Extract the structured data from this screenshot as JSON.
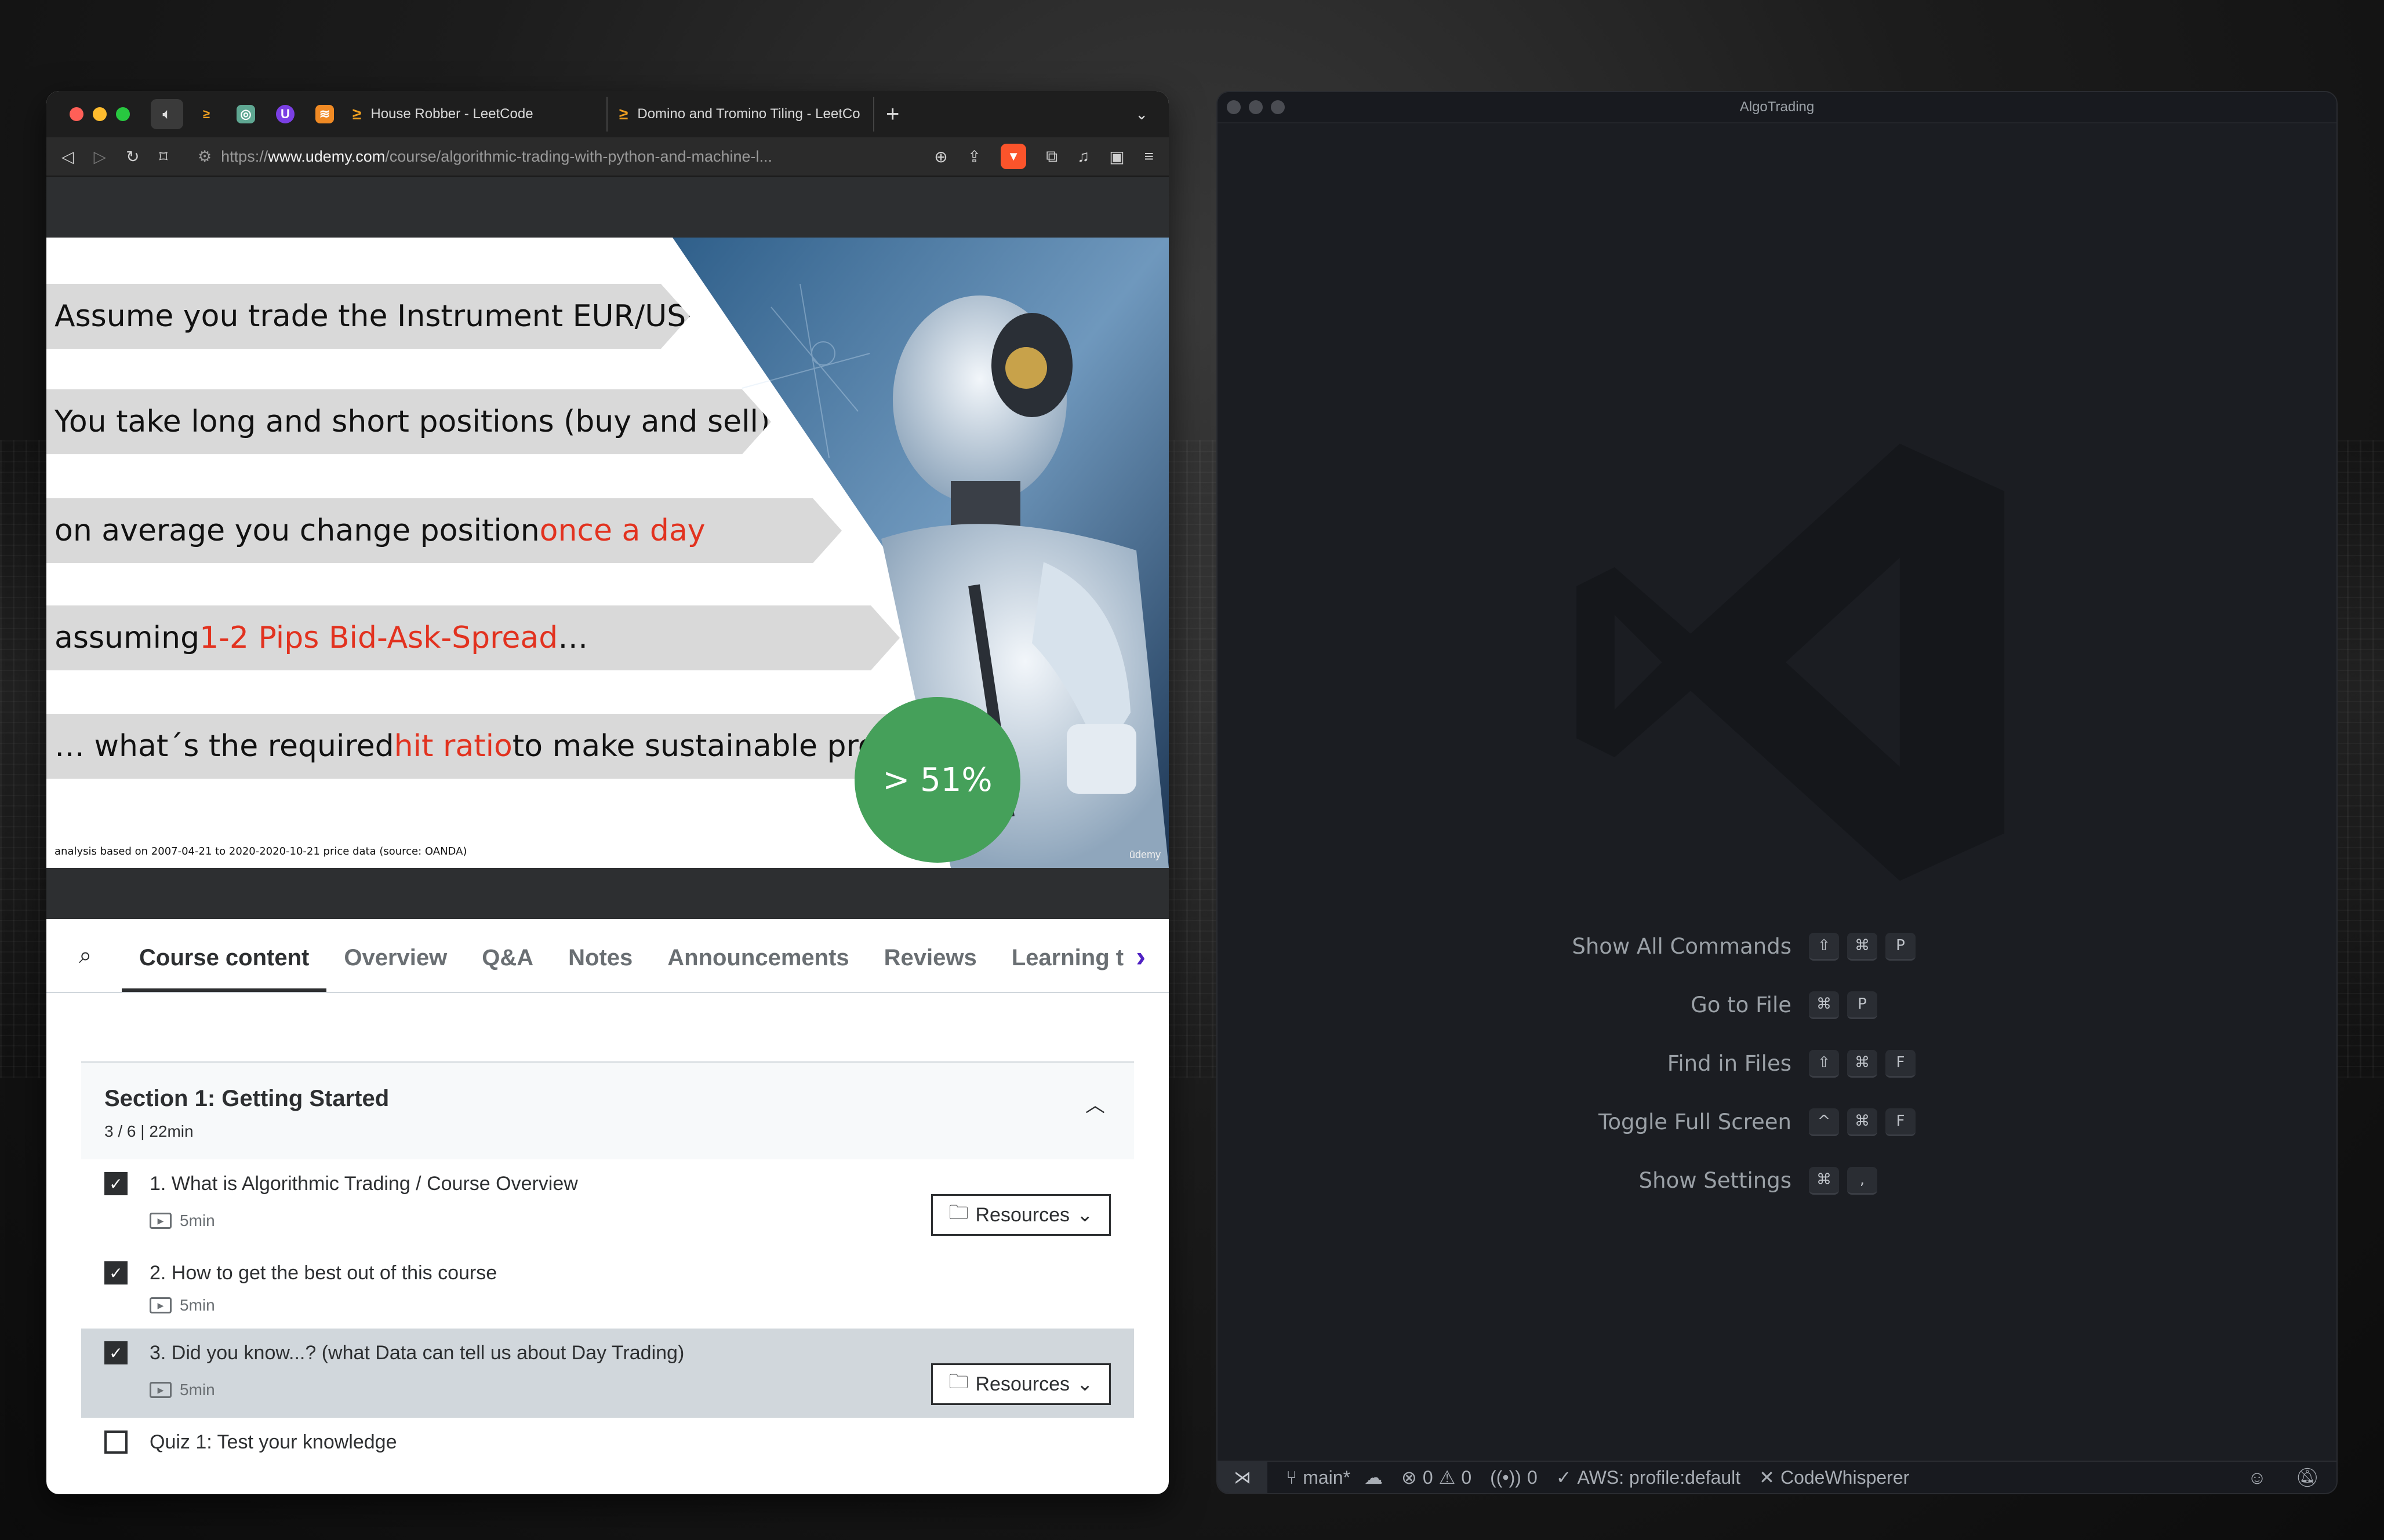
{
  "browser": {
    "tabs": [
      {
        "title": "House Robber - LeetCode"
      },
      {
        "title": "Domino and Tromino Tiling - LeetCo"
      }
    ],
    "url": {
      "prefix": "https://",
      "host": "www.udemy.com",
      "path": "/course/algorithmic-trading-with-python-and-machine-l..."
    },
    "icons": [
      "back-icon",
      "forward-icon",
      "reload-icon",
      "bookmark-icon",
      "site-info-icon",
      "zoom-icon",
      "share-icon",
      "brave-shields-icon",
      "extensions-icon",
      "media-icon",
      "sidebar-icon",
      "menu-icon"
    ]
  },
  "slide": {
    "line1": {
      "text": "Assume you trade the Instrument EUR/USD"
    },
    "line2": {
      "text": "You take long and short positions (buy and sell)"
    },
    "line3": {
      "pre": "on average you change position ",
      "red": "once a day",
      "post": ""
    },
    "line4": {
      "pre": "assuming ",
      "red": "1-2 Pips Bid-Ask-Spread",
      "post": " …"
    },
    "line5": {
      "pre": "… what´s the required ",
      "red": "hit ratio",
      "post": " to make sustainable profits?"
    },
    "badge": "> 51%",
    "footnote": "analysis based on 2007-04-21 to 2020-2020-10-21 price data (source: OANDA)",
    "watermark": "ūdemy",
    "colors": {
      "arrow": "#d9d9d9",
      "highlight": "#e2321f",
      "badge": "#45a05a"
    }
  },
  "course_nav": {
    "tabs": [
      "Course content",
      "Overview",
      "Q&A",
      "Notes",
      "Announcements",
      "Reviews",
      "Learning t"
    ],
    "active": "Course content"
  },
  "section": {
    "title": "Section 1: Getting Started",
    "meta": "3 / 6 | 22min",
    "lectures": [
      {
        "title": "1. What is Algorithmic Trading / Course Overview",
        "duration": "5min",
        "done": true,
        "resources": "Resources"
      },
      {
        "title": "2. How to get the best out of this course",
        "duration": "5min",
        "done": true
      },
      {
        "title": "3. Did you know...? (what Data can tell us about Day Trading)",
        "duration": "5min",
        "done": true,
        "resources": "Resources"
      },
      {
        "title": "Quiz 1: Test your knowledge",
        "done": false
      }
    ]
  },
  "vscode": {
    "title": "AlgoTrading",
    "shortcuts": [
      {
        "label": "Show All Commands",
        "keys": [
          "⇧",
          "⌘",
          "P"
        ]
      },
      {
        "label": "Go to File",
        "keys": [
          "⌘",
          "P"
        ]
      },
      {
        "label": "Find in Files",
        "keys": [
          "⇧",
          "⌘",
          "F"
        ]
      },
      {
        "label": "Toggle Full Screen",
        "keys": [
          "^",
          "⌘",
          "F"
        ]
      },
      {
        "label": "Show Settings",
        "keys": [
          "⌘",
          ","
        ]
      }
    ],
    "status": {
      "branch": "main*",
      "errors": "0",
      "warnings": "0",
      "ports": "0",
      "aws": "AWS: profile:default",
      "codewhisperer": "CodeWhisperer"
    }
  }
}
